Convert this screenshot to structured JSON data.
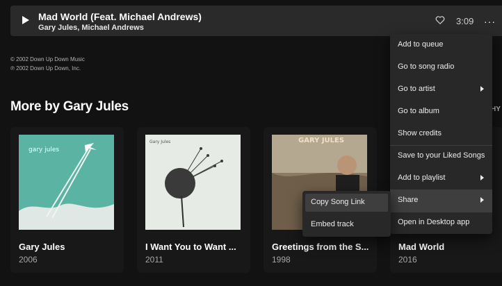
{
  "track": {
    "title": "Mad World (Feat. Michael Andrews)",
    "artists": "Gary Jules, Michael Andrews",
    "duration": "3:09",
    "more_label": "···"
  },
  "copyright": {
    "line1": "© 2002 Down Up Down Music",
    "line2": "℗ 2002 Down Up Down, Inc."
  },
  "section": {
    "title": "More by Gary Jules",
    "cut_off_text": "HY"
  },
  "albums": [
    {
      "title": "Gary Jules",
      "year": "2006",
      "cover_text": "gary jules"
    },
    {
      "title": "I Want You to Want ...",
      "year": "2011",
      "cover_text": "Gary Jules"
    },
    {
      "title": "Greetings from the S...",
      "year": "1998",
      "cover_text": "GARY JULES"
    },
    {
      "title": "Mad World",
      "year": "2016"
    }
  ],
  "context_menu": {
    "items": [
      {
        "label": "Add to queue"
      },
      {
        "label": "Go to song radio"
      },
      {
        "label": "Go to artist",
        "has_submenu": true
      },
      {
        "label": "Go to album"
      },
      {
        "label": "Show credits"
      },
      {
        "label": "Save to your Liked Songs"
      },
      {
        "label": "Add to playlist",
        "has_submenu": true
      },
      {
        "label": "Share",
        "has_submenu": true,
        "active": true
      },
      {
        "label": "Open in Desktop app"
      }
    ]
  },
  "share_submenu": {
    "items": [
      {
        "label": "Copy Song Link",
        "active": true
      },
      {
        "label": "Embed track"
      }
    ]
  },
  "colors": {
    "background": "#121212",
    "row_bg": "#2a2a2a",
    "card_bg": "#181818",
    "menu_bg": "#282828",
    "menu_hover": "#3e3e3e"
  }
}
